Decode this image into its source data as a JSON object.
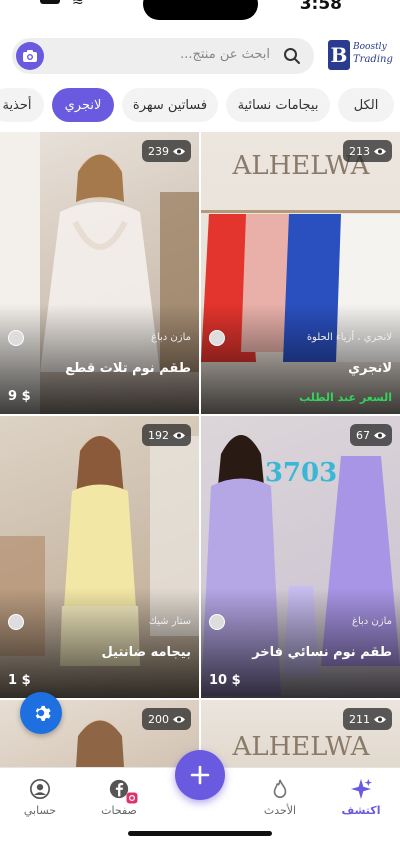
{
  "status": {
    "time": "3:58"
  },
  "search": {
    "placeholder": "ابحث عن منتج..."
  },
  "logo": {
    "line1": "Boostly",
    "line2": "Trading"
  },
  "categories": [
    {
      "label": "الكل",
      "active": false
    },
    {
      "label": "بيجامات نسائية",
      "active": false
    },
    {
      "label": "فساتين سهرة",
      "active": false
    },
    {
      "label": "لانجري",
      "active": true
    },
    {
      "label": "أحذية",
      "active": false
    }
  ],
  "products": [
    {
      "views": "239",
      "seller": "مازن دباغ",
      "title": "طقم نوم تلات قطع",
      "price": "9 $"
    },
    {
      "views": "213",
      "seller": "لانجري ، أزياء الحلوة",
      "title": "لانجري",
      "price_note": "السعر عند الطلب",
      "sign_text": "ALHELWA"
    },
    {
      "views": "192",
      "seller": "ستار شيك",
      "title": "بيجامه ضانتيل",
      "price": "1 $"
    },
    {
      "views": "67",
      "seller": "مازن دباغ",
      "title": "طقم نوم نسائي فاخر",
      "price": "10 $",
      "overlay_number": "3703"
    },
    {
      "views": "200"
    },
    {
      "views": "211",
      "sign_text": "ALHELWA"
    }
  ],
  "nav": {
    "explore": "اكتشف",
    "latest": "الأحدث",
    "pages": "صفحات",
    "account": "حسابي"
  },
  "colors": {
    "accent": "#6a5ae0",
    "price_note": "#35d25b",
    "gear": "#1e6fe0"
  },
  "icons": [
    "camera-icon",
    "search-icon",
    "eye-icon",
    "gear-icon",
    "sparkle-icon",
    "flame-icon",
    "plus-icon",
    "facebook-icon",
    "instagram-icon",
    "user-icon"
  ]
}
